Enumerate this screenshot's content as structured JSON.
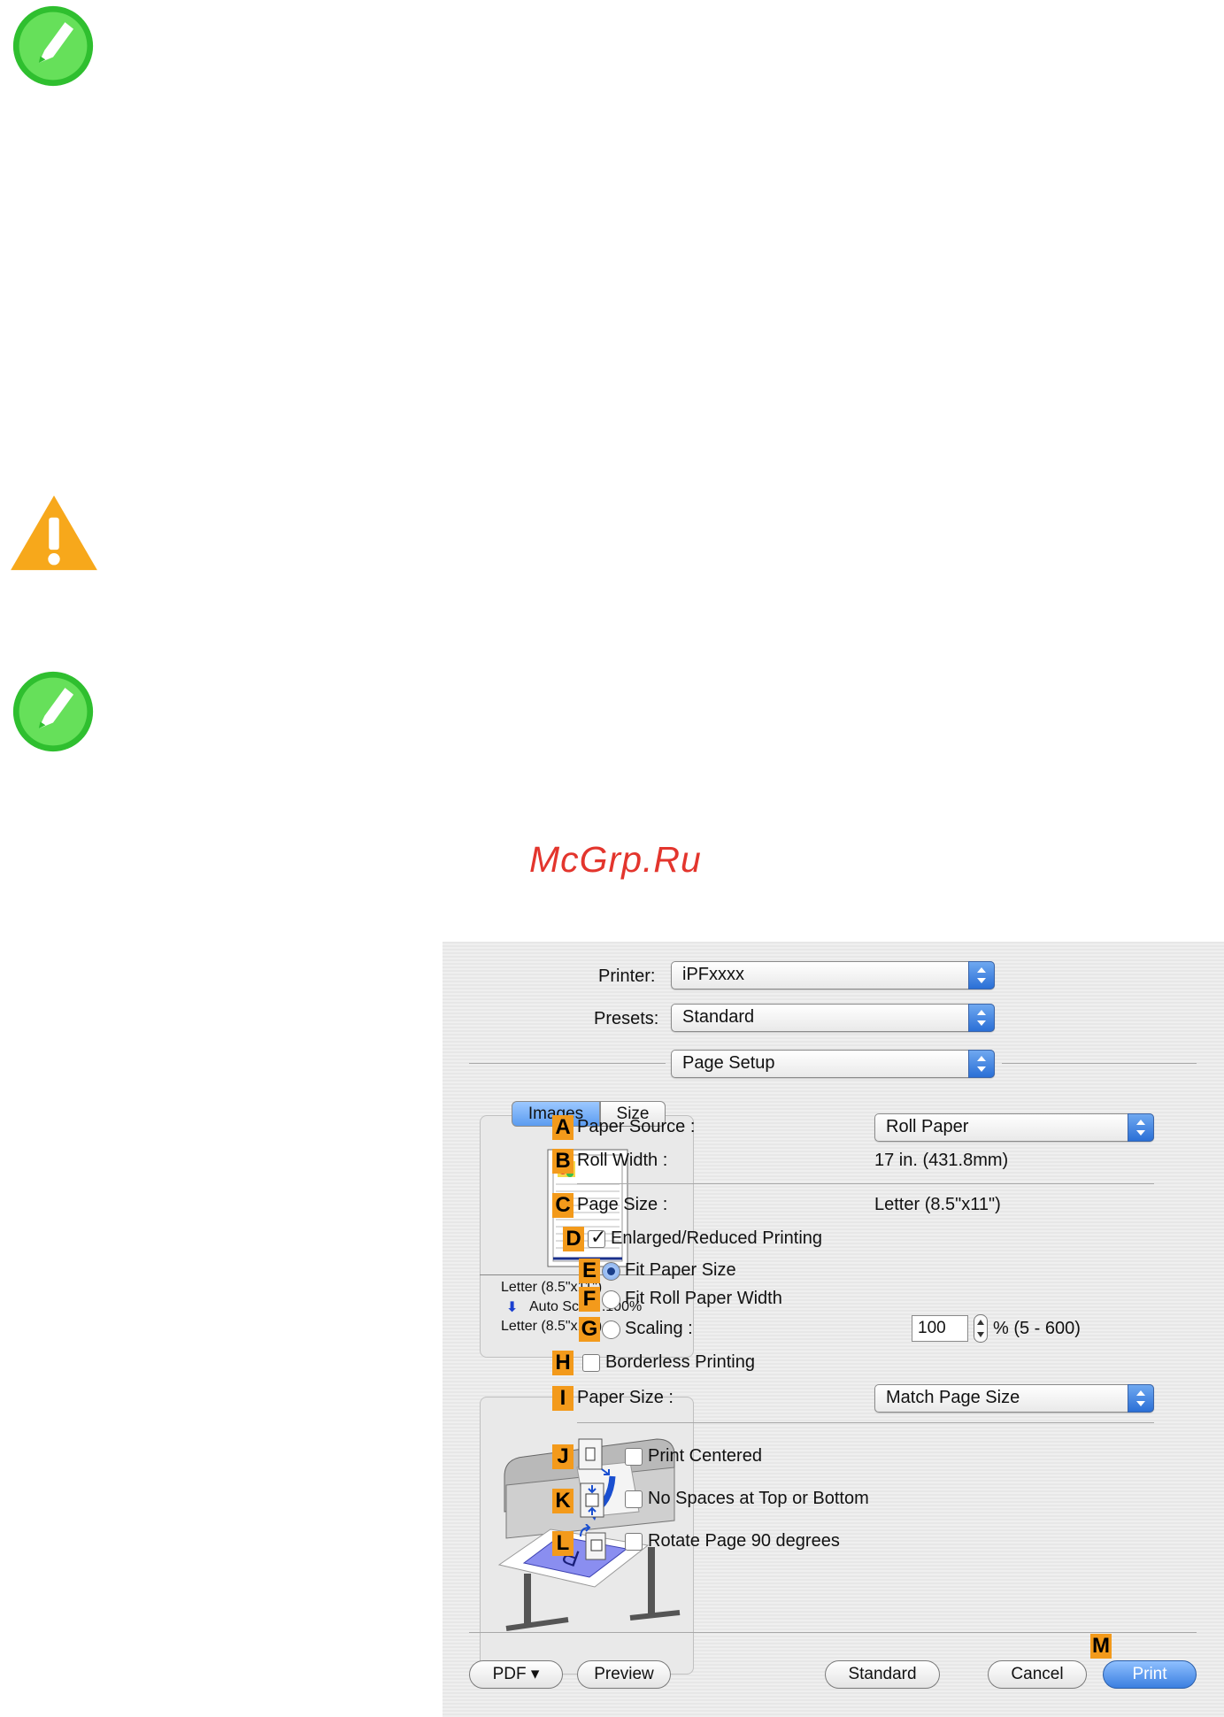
{
  "watermark": "McGrp.Ru",
  "dialog": {
    "printer_label": "Printer:",
    "printer_value": "iPFxxxx",
    "presets_label": "Presets:",
    "presets_value": "Standard",
    "panel_value": "Page Setup",
    "tabs": [
      "Images",
      "Size"
    ],
    "preview_text": {
      "line1": "Letter (8.5\"x11\")",
      "line2": "Auto Scale :100%",
      "line3": "Letter (8.5\"x11\")"
    },
    "options": {
      "A": {
        "badge": "A",
        "label": "Paper Source :",
        "value": "Roll Paper"
      },
      "B": {
        "badge": "B",
        "label": "Roll Width :",
        "value": "17 in. (431.8mm)"
      },
      "C": {
        "badge": "C",
        "label": "Page Size :",
        "value": "Letter (8.5\"x11\")"
      },
      "D": {
        "badge": "D",
        "label": "Enlarged/Reduced Printing",
        "checked": true
      },
      "E": {
        "badge": "E",
        "label": "Fit Paper Size",
        "selected": true
      },
      "F": {
        "badge": "F",
        "label": "Fit Roll Paper Width",
        "selected": false
      },
      "G": {
        "badge": "G",
        "label": "Scaling :",
        "value": "100",
        "range": "% (5 - 600)",
        "selected": false
      },
      "H": {
        "badge": "H",
        "label": "Borderless Printing",
        "checked": false
      },
      "I": {
        "badge": "I",
        "label": "Paper Size :",
        "value": "Match Page Size"
      },
      "J": {
        "badge": "J",
        "label": "Print Centered",
        "checked": false
      },
      "K": {
        "badge": "K",
        "label": "No Spaces at Top or Bottom",
        "checked": false
      },
      "L": {
        "badge": "L",
        "label": "Rotate Page 90 degrees",
        "checked": false
      },
      "M": {
        "badge": "M"
      }
    },
    "buttons": {
      "pdf": "PDF ▾",
      "preview": "Preview",
      "standard": "Standard",
      "cancel": "Cancel",
      "print": "Print"
    },
    "colors": {
      "badge": "#f39a1b",
      "accent": "#3b7fe0"
    }
  }
}
